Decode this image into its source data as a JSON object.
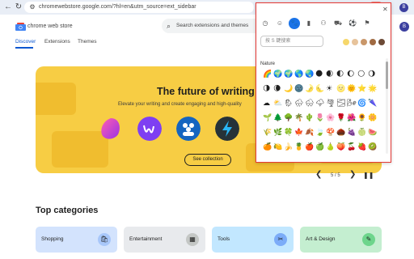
{
  "browser": {
    "url": "chromewebstore.google.com/?hl=en&utm_source=ext_sidebar",
    "profile_initial": "B",
    "extension_badge": "P"
  },
  "store": {
    "name": "chrome web store",
    "tabs": [
      "Discover",
      "Extensions",
      "Themes"
    ],
    "search_placeholder": "Search extensions and themes",
    "profile_initial": "B"
  },
  "banner": {
    "title": "The future of writing",
    "subtitle": "Elevate your writing and create engaging and high-quality",
    "cta": "See collection",
    "counter": "5 / 5"
  },
  "categories": {
    "title": "Top categories",
    "items": [
      {
        "label": "Shopping",
        "color": "#d3e3fd",
        "icon": "bag-icon",
        "icon_bg": "#a8c7fa",
        "icon_glyph": "🛍"
      },
      {
        "label": "Entertainment",
        "color": "#e8eaed",
        "icon": "media-icon",
        "icon_bg": "#c4c7c5",
        "icon_glyph": "▦"
      },
      {
        "label": "Tools",
        "color": "#c2e7ff",
        "icon": "tools-icon",
        "icon_bg": "#7cacf8",
        "icon_glyph": "✂"
      },
      {
        "label": "Art & Design",
        "color": "#c4eed0",
        "icon": "pencil-icon",
        "icon_bg": "#6dd58c",
        "icon_glyph": "✎"
      }
    ]
  },
  "picker": {
    "search_placeholder": "按 S 鍵搜索",
    "section_label": "Nature",
    "category_icons": [
      "clock-icon",
      "smiley-icon",
      "paw-icon",
      "bars-icon",
      "people-icon",
      "car-icon",
      "ball-icon",
      "flag-icon"
    ],
    "category_glyphs": [
      "◷",
      "☺",
      "🐾",
      "▮",
      "⚇",
      "⛟",
      "⚽",
      "⚑"
    ],
    "tones": [
      "#f6d76b",
      "#e7c39b",
      "#c9976a",
      "#a06a42",
      "#6d4a36"
    ],
    "emoji_rows": [
      [
        "🌈",
        "🌍",
        "🌍",
        "🌎",
        "🌏",
        "🌑",
        "🌒",
        "🌓",
        "🌔",
        "🌕",
        "🌖"
      ],
      [
        "🌗",
        "🌘",
        "🌙",
        "🌚",
        "🌛",
        "🌜",
        "☀",
        "🌝",
        "🌞",
        "⭐",
        "🌟"
      ],
      [
        "☁",
        "⛅",
        "🌦",
        "🌧",
        "🌨",
        "🌩",
        "🌪",
        "🌫",
        "🌬",
        "🌀",
        "🌂"
      ],
      [
        "🌱",
        "🌲",
        "🌳",
        "🌴",
        "🌵",
        "🌷",
        "🌸",
        "🌹",
        "🌺",
        "🌻",
        "🌼"
      ],
      [
        "🌾",
        "🌿",
        "🍀",
        "🍁",
        "🍂",
        "🍃",
        "🍄",
        "🌰",
        "🍇",
        "🍈",
        "🍉"
      ],
      [
        "🍊",
        "🍋",
        "🍌",
        "🍍",
        "🍎",
        "🍏",
        "🍐",
        "🍑",
        "🍒",
        "🍓",
        "🥝"
      ]
    ]
  }
}
